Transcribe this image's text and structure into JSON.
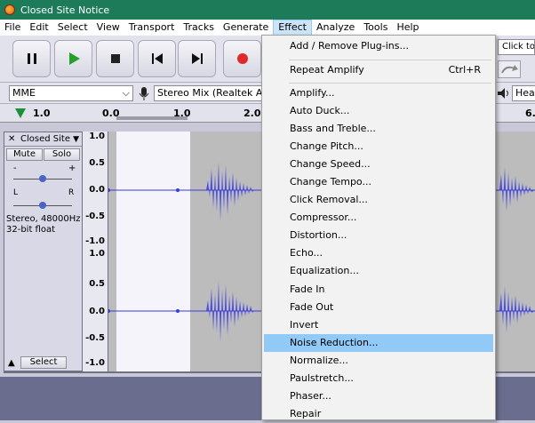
{
  "window": {
    "title": "Closed Site Notice"
  },
  "menubar": {
    "items": [
      "File",
      "Edit",
      "Select",
      "View",
      "Transport",
      "Tracks",
      "Generate",
      "Effect",
      "Analyze",
      "Tools",
      "Help"
    ],
    "active_index": 7
  },
  "toolbar": {
    "pause": "pause-icon",
    "play": "play-icon",
    "stop": "stop-icon",
    "skip_start": "skip-start-icon",
    "skip_end": "skip-end-icon",
    "record": "record-icon",
    "click_to_text": "Click to S"
  },
  "devices": {
    "host": "MME",
    "input": "Stereo Mix (Realtek Aud",
    "output": "Heac"
  },
  "timeline": {
    "ticks": [
      "1.0",
      "0.0",
      "1.0",
      "2.0",
      "6."
    ]
  },
  "track": {
    "name": "Closed Site",
    "mute": "Mute",
    "solo": "Solo",
    "gain_minus": "-",
    "gain_plus": "+",
    "pan_left": "L",
    "pan_right": "R",
    "info_line1": "Stereo, 48000Hz",
    "info_line2": "32-bit float",
    "select": "Select",
    "scale_top": [
      "1.0",
      "0.5",
      "0.0",
      "-0.5",
      "-1.0"
    ],
    "scale_bottom": [
      "1.0",
      "0.5",
      "0.0",
      "-0.5",
      "-1.0"
    ]
  },
  "effect_menu": {
    "add_remove": "Add / Remove Plug-ins...",
    "repeat": "Repeat Amplify",
    "repeat_accel": "Ctrl+R",
    "items": [
      "Amplify...",
      "Auto Duck...",
      "Bass and Treble...",
      "Change Pitch...",
      "Change Speed...",
      "Change Tempo...",
      "Click Removal...",
      "Compressor...",
      "Distortion...",
      "Echo...",
      "Equalization...",
      "Fade In",
      "Fade Out",
      "Invert",
      "Noise Reduction...",
      "Normalize...",
      "Paulstretch...",
      "Phaser...",
      "Repair"
    ],
    "highlighted_index": 14
  },
  "colors": {
    "title_bar": "#1e7b5a",
    "waveform": "#3a3ad0",
    "menu_highlight": "#91c9f7",
    "selection": "#ffffff"
  }
}
